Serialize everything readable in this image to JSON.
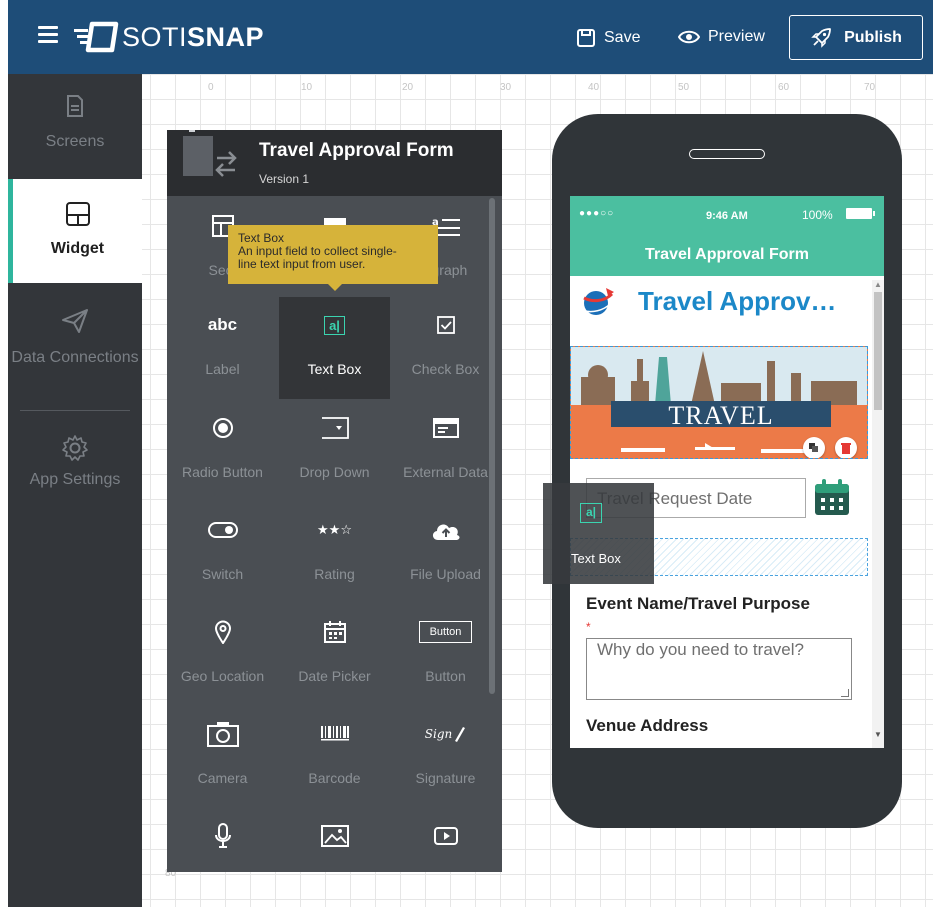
{
  "app": {
    "logo_part1": "SOTI",
    "logo_part2": "SNAP",
    "save_label": "Save",
    "preview_label": "Preview",
    "publish_label": "Publish",
    "brand_color": "#1e4d78",
    "accent_color": "#2fb59d"
  },
  "sidebar": {
    "items": [
      {
        "label": "Screens",
        "icon": "document-icon",
        "active": false
      },
      {
        "label": "Widget",
        "icon": "layout-icon",
        "active": true
      },
      {
        "label": "Data Connections",
        "icon": "send-icon",
        "active": false
      },
      {
        "label": "App Settings",
        "icon": "gear-icon",
        "active": false
      }
    ]
  },
  "ruler": {
    "ticks": [
      "0",
      "10",
      "20",
      "30",
      "40",
      "50",
      "60",
      "70"
    ],
    "left_tick": "80"
  },
  "panel": {
    "title": "Travel Approval Form",
    "version": "Version 1",
    "tooltip_title": "Text Box",
    "tooltip_desc1": "An input field to collect single-",
    "tooltip_desc2": "line text input from user.",
    "widgets": [
      {
        "label": "Sect",
        "icon": "section-icon"
      },
      {
        "label": "",
        "icon": "image-header-icon"
      },
      {
        "label": "agraph",
        "icon": "paragraph-icon"
      },
      {
        "label": "Label",
        "icon": "label-icon",
        "glyph": "abc"
      },
      {
        "label": "Text Box",
        "icon": "textbox-icon",
        "glyph": "a|"
      },
      {
        "label": "Check Box",
        "icon": "checkbox-icon"
      },
      {
        "label": "Radio Button",
        "icon": "radio-icon"
      },
      {
        "label": "Drop Down",
        "icon": "dropdown-icon"
      },
      {
        "label": "External Data",
        "icon": "external-data-icon"
      },
      {
        "label": "Switch",
        "icon": "switch-icon"
      },
      {
        "label": "Rating",
        "icon": "rating-icon",
        "glyph": "★★☆"
      },
      {
        "label": "File Upload",
        "icon": "cloud-upload-icon"
      },
      {
        "label": "Geo Location",
        "icon": "location-pin-icon"
      },
      {
        "label": "Date Picker",
        "icon": "calendar-icon"
      },
      {
        "label": "Button",
        "icon": "button-icon",
        "glyph": "Button"
      },
      {
        "label": "Camera",
        "icon": "camera-icon"
      },
      {
        "label": "Barcode",
        "icon": "barcode-icon"
      },
      {
        "label": "Signature",
        "icon": "signature-icon",
        "glyph": "Sign"
      },
      {
        "label": "",
        "icon": "microphone-icon"
      },
      {
        "label": "",
        "icon": "image-icon"
      },
      {
        "label": "",
        "icon": "video-icon"
      }
    ]
  },
  "phone": {
    "status_signal": "●●●○○",
    "status_time": "9:46 AM",
    "status_battery": "100%",
    "app_title": "Travel Approval Form",
    "form_title": "Travel Approv…",
    "banner_text": "TRAVEL",
    "date_placeholder": "Travel Request Date",
    "event_label": "Event Name/Travel Purpose",
    "required_mark": "*",
    "event_placeholder": "Why do you need to travel?",
    "venue_label": "Venue Address",
    "status_color": "#4bbfa0",
    "title_color": "#1b88c8"
  },
  "drag": {
    "label": "Text Box",
    "glyph": "a|"
  }
}
